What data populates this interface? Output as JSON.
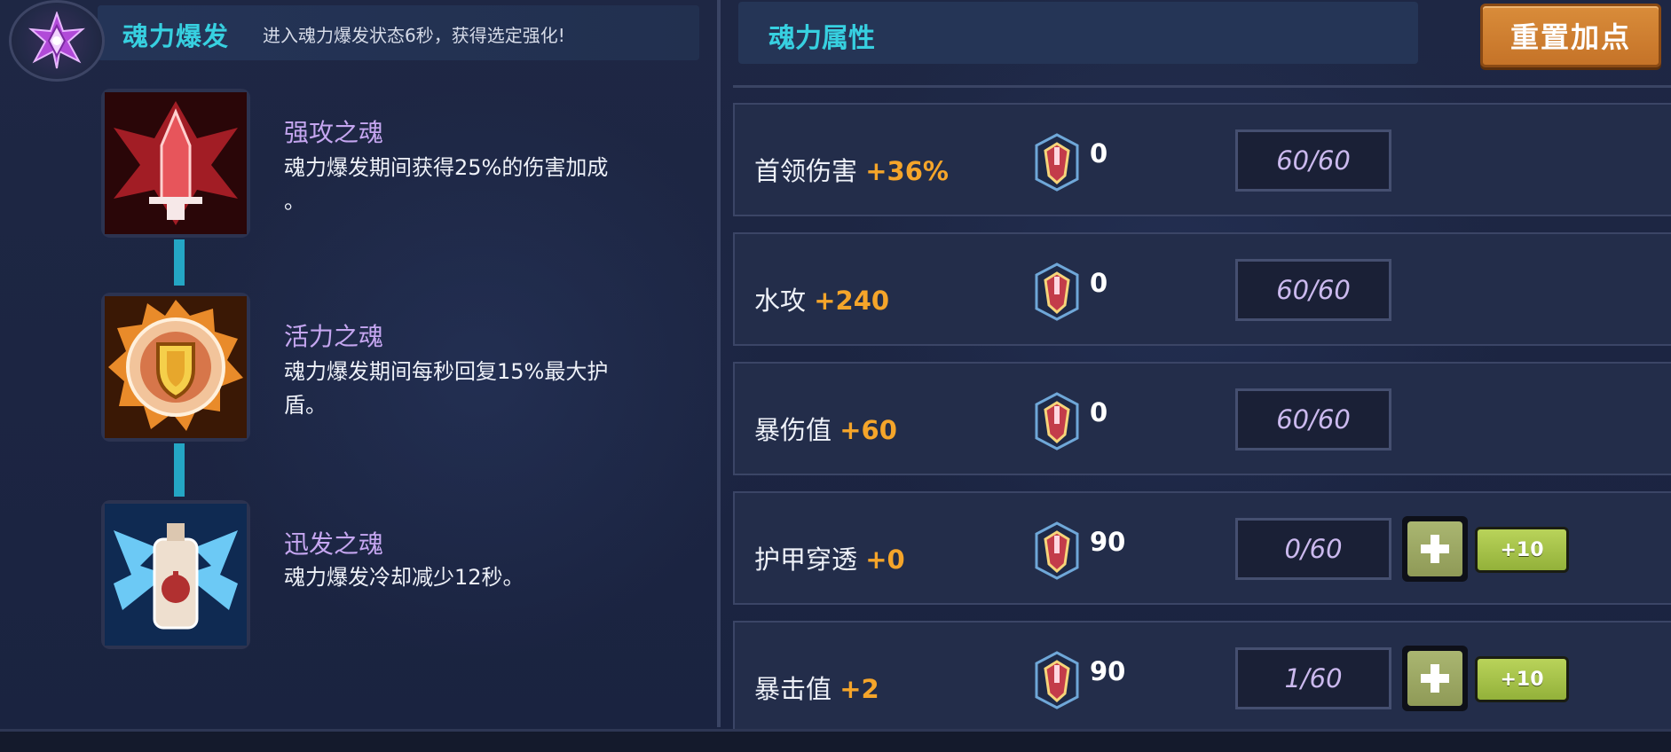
{
  "soul_burst": {
    "title": "魂力爆发",
    "description": "进入魂力爆发状态6秒，获得选定强化!"
  },
  "skills": [
    {
      "name": "强攻之魂",
      "desc_line1": "魂力爆发期间获得25%的伤害加成",
      "desc_line2": "。",
      "icon": "red-attack-soul-icon",
      "color": "#c8323a"
    },
    {
      "name": "活力之魂",
      "desc_line1": "魂力爆发期间每秒回复15%最大护",
      "desc_line2": "盾。",
      "icon": "gold-shield-soul-icon",
      "color": "#e7a24a"
    },
    {
      "name": "迅发之魂",
      "desc_line1": "魂力爆发冷却减少12秒。",
      "desc_line2": "",
      "icon": "blue-winged-soul-icon",
      "color": "#4fb6ef"
    }
  ],
  "attributes_panel": {
    "title": "魂力属性",
    "reset_label": "重置加点",
    "rows": [
      {
        "label": "首领伤害",
        "bonus": "+36%",
        "cost": "0",
        "level": "60/60",
        "plus_label": "",
        "plus10_label": ""
      },
      {
        "label": "水攻",
        "bonus": "+240",
        "cost": "0",
        "level": "60/60",
        "plus_label": "",
        "plus10_label": ""
      },
      {
        "label": "暴伤值",
        "bonus": "+60",
        "cost": "0",
        "level": "60/60",
        "plus_label": "",
        "plus10_label": ""
      },
      {
        "label": "护甲穿透",
        "bonus": "+0",
        "cost": "90",
        "level": "0/60",
        "plus_label": "+",
        "plus10_label": "+10"
      },
      {
        "label": "暴击值",
        "bonus": "+2",
        "cost": "90",
        "level": "1/60",
        "plus_label": "+",
        "plus10_label": "+10"
      }
    ]
  },
  "colors": {
    "accent_cyan": "#37d0e0",
    "bonus_orange": "#f5a52a",
    "skill_name_purple": "#c5a6f0",
    "reset_orange": "#d98c3a",
    "plus_green": "#b9d35a"
  },
  "icons": {
    "burst_emblem": "purple-star-emblem-icon",
    "cost": "soul-gem-icon",
    "plus": "plus-icon"
  }
}
